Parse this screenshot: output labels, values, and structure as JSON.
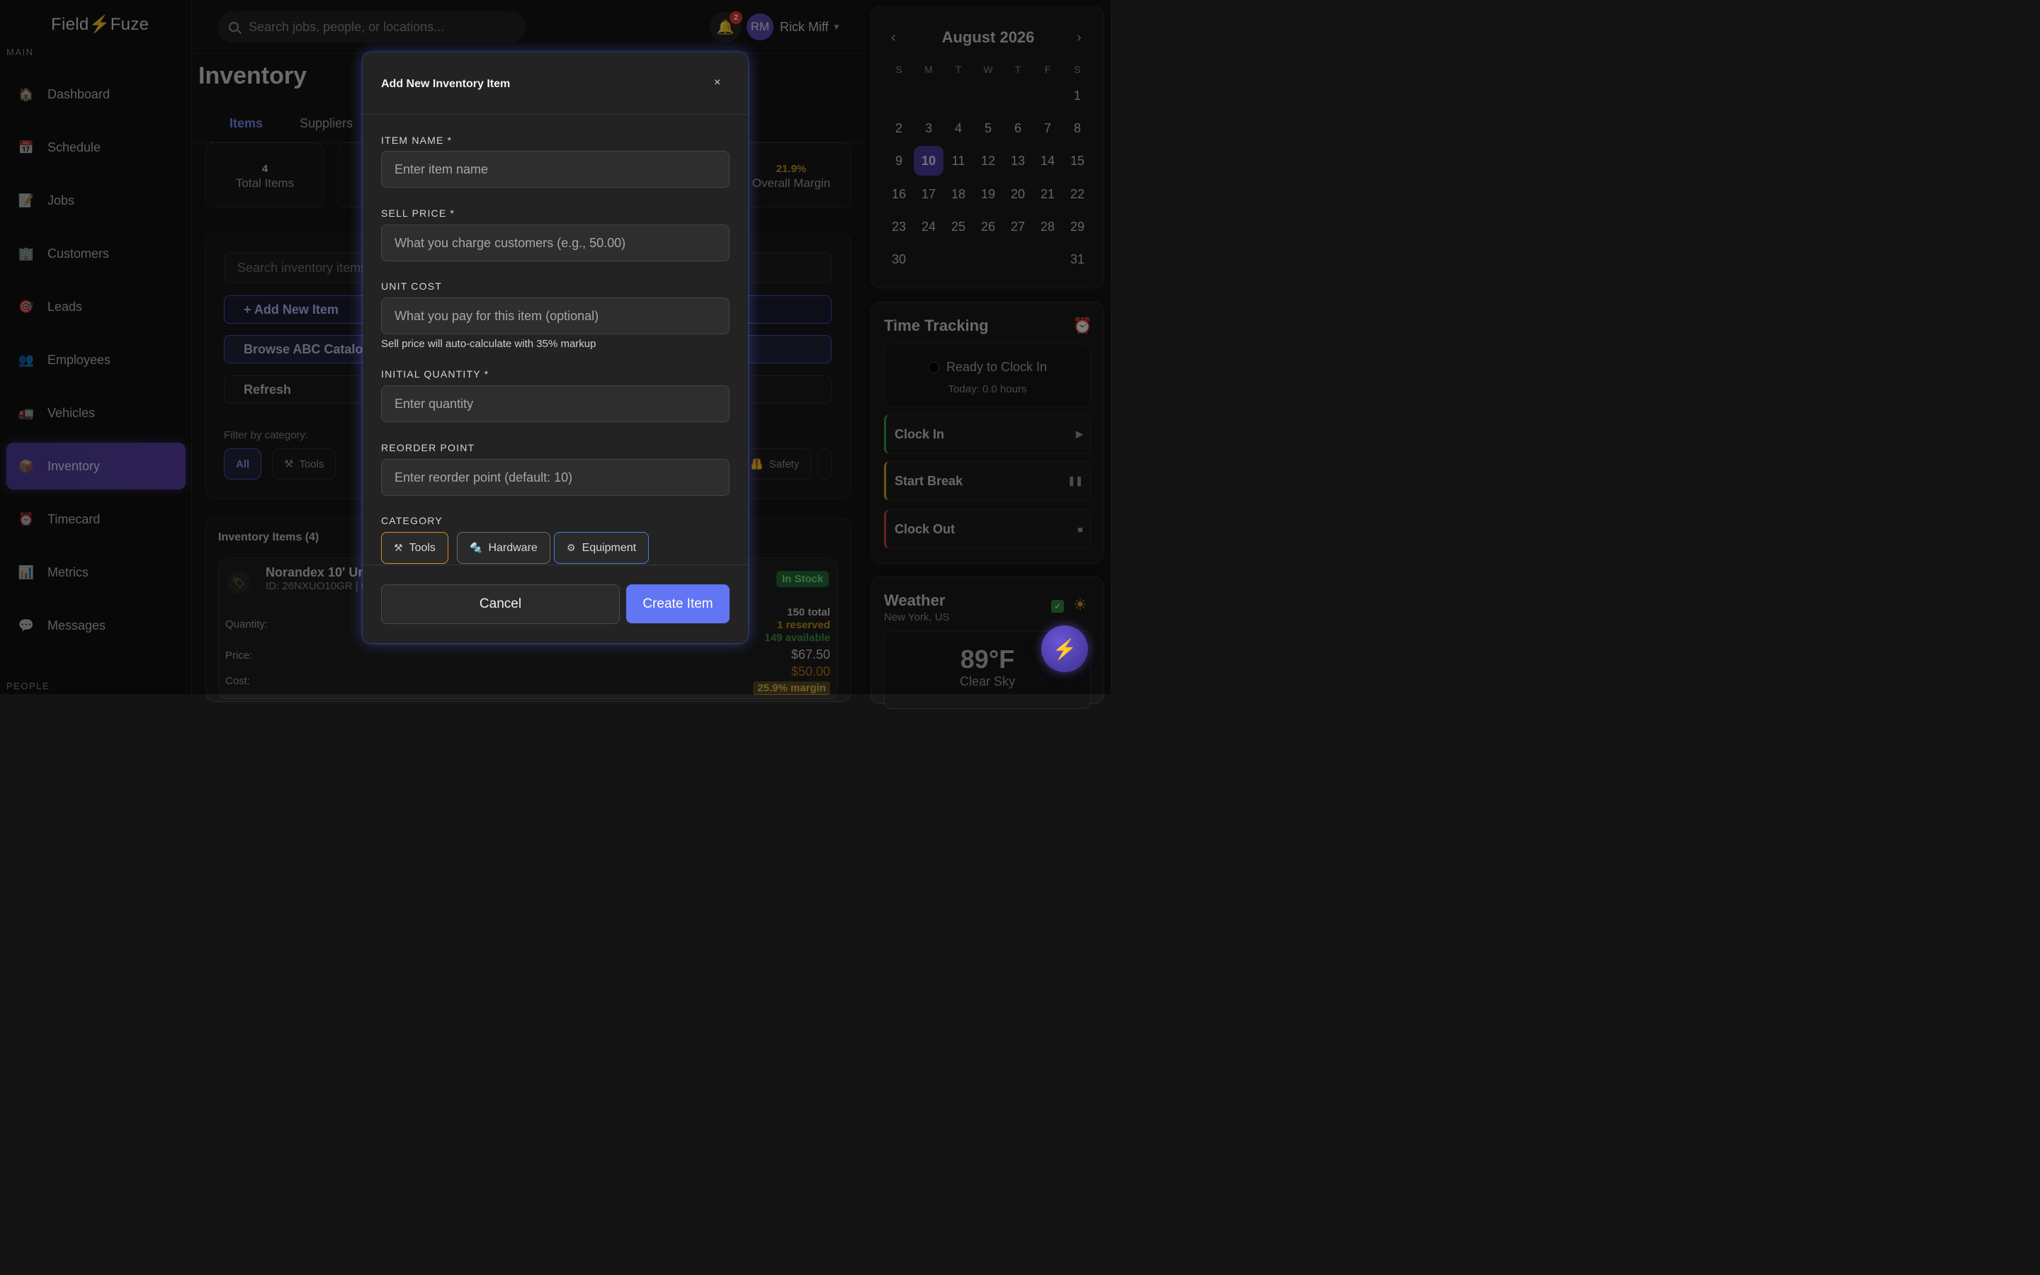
{
  "app": {
    "logo_left": "Field",
    "logo_right": "Fuze"
  },
  "sidebar": {
    "section_main": "MAIN",
    "section_people": "PEOPLE",
    "items": [
      {
        "label": "Dashboard",
        "icon": "house-icon"
      },
      {
        "label": "Schedule",
        "icon": "calendar-icon"
      },
      {
        "label": "Jobs",
        "icon": "memo-icon"
      },
      {
        "label": "Customers",
        "icon": "building-icon"
      },
      {
        "label": "Leads",
        "icon": "target-icon"
      },
      {
        "label": "Employees",
        "icon": "people-icon"
      },
      {
        "label": "Vehicles",
        "icon": "truck-icon"
      },
      {
        "label": "Inventory",
        "icon": "package-icon",
        "active": true
      },
      {
        "label": "Timecard",
        "icon": "alarm-clock-icon"
      },
      {
        "label": "Metrics",
        "icon": "bar-chart-icon"
      },
      {
        "label": "Messages",
        "icon": "speech-bubble-icon"
      }
    ]
  },
  "header": {
    "search_placeholder": "Search jobs, people, or locations...",
    "notifications": "2",
    "user_initials": "RM",
    "user_name": "Rick Miff"
  },
  "main": {
    "title": "Inventory",
    "tabs": [
      "Items",
      "Suppliers"
    ],
    "stats": [
      {
        "value": "4",
        "label": "Total Items"
      },
      {
        "value": "21.9%",
        "label": "Overall Margin"
      }
    ],
    "search_placeholder": "Search inventory items",
    "actions": [
      "+ Add New Item",
      "Browse ABC Catalog",
      "Refresh"
    ],
    "filter_label": "Filter by category:",
    "filters": [
      "All",
      "Tools",
      "Safety"
    ],
    "items_title": "Inventory Items (4)",
    "item": {
      "name": "Norandex 10' Un",
      "id": "ID: 26NXUO10GR | C",
      "status": "In Stock",
      "quantity_label": "Quantity:",
      "price_label": "Price:",
      "cost_label": "Cost:",
      "total": "150 total",
      "reserved": "1 reserved",
      "available": "149 available",
      "price": "$67.50",
      "cost": "$50.00",
      "margin": "25.9% margin"
    }
  },
  "calendar": {
    "month": "August 2026",
    "dow": [
      "S",
      "M",
      "T",
      "W",
      "T",
      "F",
      "S"
    ],
    "today": "10",
    "weeks": [
      [
        "",
        "",
        "",
        "",
        "",
        "",
        "1"
      ],
      [
        "2",
        "3",
        "4",
        "5",
        "6",
        "7",
        "8"
      ],
      [
        "9",
        "10",
        "11",
        "12",
        "13",
        "14",
        "15"
      ],
      [
        "16",
        "17",
        "18",
        "19",
        "20",
        "21",
        "22"
      ],
      [
        "23",
        "24",
        "25",
        "26",
        "27",
        "28",
        "29"
      ],
      [
        "30",
        "",
        "",
        "",
        "",
        "",
        "31"
      ]
    ]
  },
  "time_tracking": {
    "title": "Time Tracking",
    "status": "Ready to Clock In",
    "today": "Today: 0.0 hours",
    "buttons": [
      {
        "label": "Clock In",
        "color": "#3aa34a",
        "icon": "▶"
      },
      {
        "label": "Start Break",
        "color": "#d9a520",
        "icon": "❚❚"
      },
      {
        "label": "Clock Out",
        "color": "#d84040",
        "icon": "■"
      }
    ]
  },
  "weather": {
    "title": "Weather",
    "location": "New York, US",
    "temp": "89°F",
    "condition": "Clear Sky"
  },
  "modal": {
    "title": "Add New Inventory Item",
    "close": "×",
    "fields": {
      "item_name": {
        "label": "ITEM NAME *",
        "placeholder": "Enter item name"
      },
      "sell_price": {
        "label": "SELL PRICE *",
        "placeholder": "What you charge customers (e.g., 50.00)"
      },
      "unit_cost": {
        "label": "UNIT COST",
        "placeholder": "What you pay for this item (optional)"
      },
      "initial_quantity": {
        "label": "INITIAL QUANTITY *",
        "placeholder": "Enter quantity"
      },
      "reorder_point": {
        "label": "REORDER POINT",
        "placeholder": "Enter reorder point (default: 10)"
      }
    },
    "hint": "Sell price will auto-calculate with 35% markup",
    "category_label": "CATEGORY",
    "categories": [
      {
        "label": "Tools",
        "border": "#e08a2a"
      },
      {
        "label": "Hardware",
        "border": "#6a6a6a"
      },
      {
        "label": "Equipment",
        "border": "#4a7ee0"
      }
    ],
    "cancel": "Cancel",
    "create": "Create Item"
  }
}
